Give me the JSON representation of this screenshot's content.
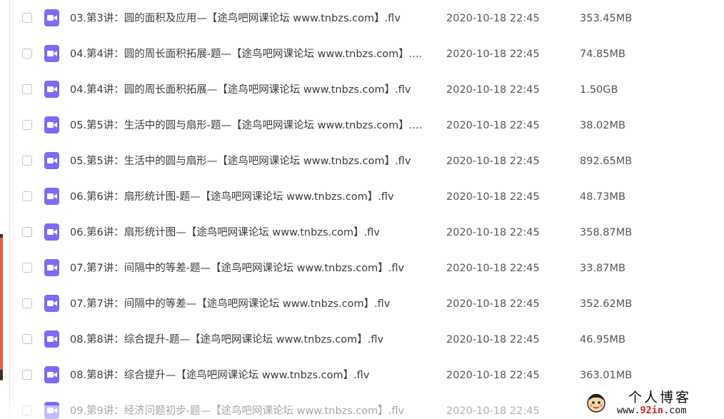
{
  "files": [
    {
      "name": "03.第3讲：圆的面积及应用—【途鸟吧网课论坛 www.tnbzs.com】.flv",
      "date": "2020-10-18 22:45",
      "size": "353.45MB"
    },
    {
      "name": "04.第4讲：圆的周长面积拓展-题—【途鸟吧网课论坛 www.tnbzs.com】....",
      "date": "2020-10-18 22:45",
      "size": "74.85MB"
    },
    {
      "name": "04.第4讲：圆的周长面积拓展—【途鸟吧网课论坛 www.tnbzs.com】.flv",
      "date": "2020-10-18 22:45",
      "size": "1.50GB"
    },
    {
      "name": "05.第5讲：生活中的圆与扇形-题—【途鸟吧网课论坛 www.tnbzs.com】....",
      "date": "2020-10-18 22:45",
      "size": "38.02MB"
    },
    {
      "name": "05.第5讲：生活中的圆与扇形—【途鸟吧网课论坛 www.tnbzs.com】.flv",
      "date": "2020-10-18 22:45",
      "size": "892.65MB"
    },
    {
      "name": "06.第6讲：扇形统计图-题—【途鸟吧网课论坛 www.tnbzs.com】.flv",
      "date": "2020-10-18 22:45",
      "size": "48.73MB"
    },
    {
      "name": "06.第6讲：扇形统计图—【途鸟吧网课论坛 www.tnbzs.com】.flv",
      "date": "2020-10-18 22:45",
      "size": "358.87MB"
    },
    {
      "name": "07.第7讲：间隔中的等差-题—【途鸟吧网课论坛 www.tnbzs.com】.flv",
      "date": "2020-10-18 22:45",
      "size": "33.87MB"
    },
    {
      "name": "07.第7讲：间隔中的等差—【途鸟吧网课论坛 www.tnbzs.com】.flv",
      "date": "2020-10-18 22:45",
      "size": "352.62MB"
    },
    {
      "name": "08.第8讲：综合提升-题—【途鸟吧网课论坛 www.tnbzs.com】.flv",
      "date": "2020-10-18 22:45",
      "size": "46.95MB"
    },
    {
      "name": "08.第8讲：综合提升—【途鸟吧网课论坛 www.tnbzs.com】.flv",
      "date": "2020-10-18 22:45",
      "size": "363.01MB"
    },
    {
      "name": "09.第9讲：经济问题初步-题—【途鸟吧网课论坛 www.tnbzs.com】.flv",
      "date": "2020-10-18 22:45",
      "size": ""
    }
  ],
  "icons": {
    "file_type": "video-file-icon",
    "checkbox": "checkbox-icon"
  },
  "colors": {
    "video_icon_bg": "#7b6cf6",
    "text": "#3b3b45",
    "meta_text": "#555560",
    "watermark_url": "#d0261e"
  },
  "watermark": {
    "title": "个人博客",
    "url_prefix": "www.",
    "url_domain": "92in",
    "url_suffix": ".com"
  }
}
